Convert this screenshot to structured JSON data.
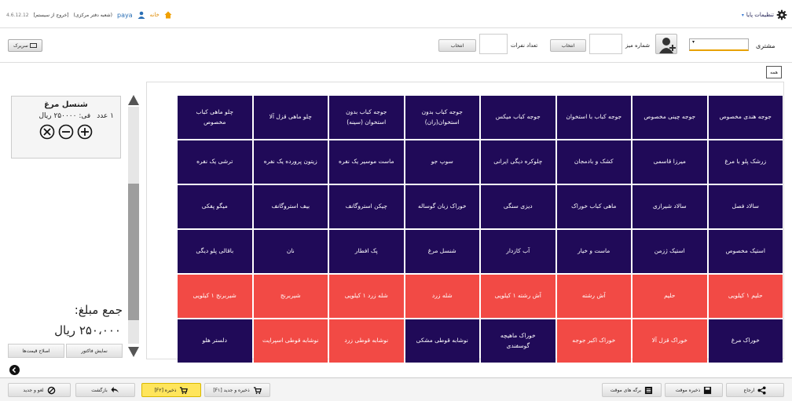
{
  "topbar": {
    "settings_label": "تنظیمات پایا",
    "home_label": "خانه",
    "user_name": "paya",
    "branch": "(شعبه دفتر مرکزی)",
    "logout": "[خروج از سیستم]",
    "version": "4.6.12.12"
  },
  "form": {
    "customer_label": "مشتری",
    "table_no_label": "شماره میز",
    "select_button": "انتخاب",
    "guests_label": "تعداد نفرات",
    "select_button_2": "انتخاب",
    "quick_button": "سریرک"
  },
  "category": {
    "all_label": "همه"
  },
  "order": {
    "item_name": "شنسل مرغ",
    "qty": "۱ عدد",
    "unit_price": "فی: ۲۵۰۰۰۰ ریال",
    "total_label": "جمع مبلغ:",
    "total_value": "۲۵۰،۰۰۰ ریال",
    "show_invoice": "نمایش فاکتور",
    "fix_prices": "اصلاح قیمت‌ها"
  },
  "menu_items": [
    {
      "label": "جوجه هندی مخصوص",
      "color": "#200a58"
    },
    {
      "label": "جوجه چینی مخصوص",
      "color": "#200a58"
    },
    {
      "label": "جوجه کباب با استخوان",
      "color": "#200a58"
    },
    {
      "label": "جوجه کباب میکس",
      "color": "#200a58"
    },
    {
      "label": "جوجه کباب بدون\nاستخوان(ران)",
      "color": "#200a58"
    },
    {
      "label": "جوجه کباب بدون\nاستخوان (سینه)",
      "color": "#200a58"
    },
    {
      "label": "چلو ماهی قزل آلا",
      "color": "#200a58"
    },
    {
      "label": "چلو ماهی کباب\nمخصوص",
      "color": "#200a58"
    },
    {
      "label": "زرشک پلو با مرغ",
      "color": "#200a58"
    },
    {
      "label": "میرزا قاسمی",
      "color": "#200a58"
    },
    {
      "label": "کشک و بادمجان",
      "color": "#200a58"
    },
    {
      "label": "چلوکره دیگی ایرانی",
      "color": "#200a58"
    },
    {
      "label": "سوپ جو",
      "color": "#200a58"
    },
    {
      "label": "ماست موسیر یک نفره",
      "color": "#200a58"
    },
    {
      "label": "زیتون پرورده یک نفره",
      "color": "#200a58"
    },
    {
      "label": "ترشی یک نفره",
      "color": "#200a58"
    },
    {
      "label": "سالاد فصل",
      "color": "#200a58"
    },
    {
      "label": "سالاد شیرازی",
      "color": "#200a58"
    },
    {
      "label": "ماهی کباب خوراک",
      "color": "#200a58"
    },
    {
      "label": "دیزی سنگی",
      "color": "#200a58"
    },
    {
      "label": "خوراک زبان گوساله",
      "color": "#200a58"
    },
    {
      "label": "چیکن استروگانف",
      "color": "#200a58"
    },
    {
      "label": "بیف استروگانف",
      "color": "#200a58"
    },
    {
      "label": "میگو پفکی",
      "color": "#200a58"
    },
    {
      "label": "استیک مخصوص",
      "color": "#200a58"
    },
    {
      "label": "استیک ژزمن",
      "color": "#200a58"
    },
    {
      "label": "ماست و خیار",
      "color": "#200a58"
    },
    {
      "label": "آب کازدار",
      "color": "#200a58"
    },
    {
      "label": "شنسل مرغ",
      "color": "#200a58"
    },
    {
      "label": "پک افطار",
      "color": "#200a58"
    },
    {
      "label": "نان",
      "color": "#200a58"
    },
    {
      "label": "باقالی پلو دیگی",
      "color": "#200a58"
    },
    {
      "label": "حلیم ۱ کیلویی",
      "color": "#f24a45"
    },
    {
      "label": "حلیم",
      "color": "#f24a45"
    },
    {
      "label": "آش رشته",
      "color": "#f24a45"
    },
    {
      "label": "آش رشته ۱ کیلویی",
      "color": "#f24a45"
    },
    {
      "label": "شله زرد",
      "color": "#f24a45"
    },
    {
      "label": "شله زرد ۱ کیلویی",
      "color": "#f24a45"
    },
    {
      "label": "شیربرنج",
      "color": "#f24a45"
    },
    {
      "label": "شیربرنج ۱ کیلویی",
      "color": "#f24a45"
    },
    {
      "label": "خوراک مرغ",
      "color": "#200a58"
    },
    {
      "label": "خوراک قزل آلا",
      "color": "#f24a45"
    },
    {
      "label": "خوراک اکبر جوجه",
      "color": "#f24a45"
    },
    {
      "label": "خوراک ماهیچه\nگوسفندی",
      "color": "#200a58"
    },
    {
      "label": "نوشابه قوطی مشکی",
      "color": "#200a58"
    },
    {
      "label": "نوشابه قوطی زرد",
      "color": "#f24a45"
    },
    {
      "label": "نوشابه قوطی اسپرایت",
      "color": "#f24a45"
    },
    {
      "label": "دلستر هلو",
      "color": "#200a58"
    }
  ],
  "bottombar": {
    "refer": "ارجاع",
    "temp_save": "ذخیره موقت",
    "temp_slips": "برگه های موقت",
    "save_new": "ذخیره و جدید [F۱]",
    "save": "ذخیره [F۲]",
    "back": "بازگشت",
    "cancel_new": "لغو و جدید"
  }
}
